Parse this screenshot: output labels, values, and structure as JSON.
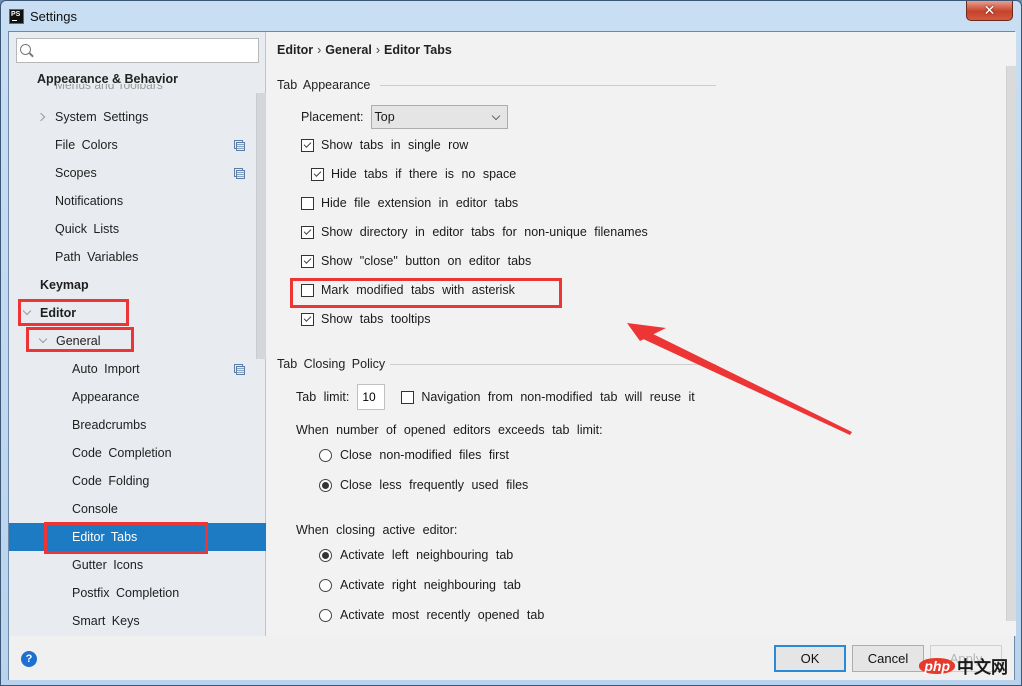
{
  "window": {
    "title": "Settings",
    "app_icon": "phpstorm-logo",
    "close_label": "✕"
  },
  "sidebar": {
    "search": {
      "value": "",
      "placeholder": ""
    },
    "section_header": "Appearance & Behavior",
    "cut_item": "Menus and Toolbars",
    "items": [
      {
        "label": "System  Settings",
        "level": 1,
        "expander": "collapsed"
      },
      {
        "label": "File  Colors",
        "level": 1,
        "project_icon": true
      },
      {
        "label": "Scopes",
        "level": 1,
        "project_icon": true
      },
      {
        "label": "Notifications",
        "level": 1
      },
      {
        "label": "Quick  Lists",
        "level": 1
      },
      {
        "label": "Path  Variables",
        "level": 1
      },
      {
        "label": "Keymap",
        "level": 0,
        "bold": true
      },
      {
        "label": "Editor",
        "level": 0,
        "bold": true,
        "expander": "expanded",
        "highlighted": true
      },
      {
        "label": "General",
        "level": 1,
        "expander": "expanded",
        "highlighted": true
      },
      {
        "label": "Auto  Import",
        "level": 2,
        "project_icon": true
      },
      {
        "label": "Appearance",
        "level": 2
      },
      {
        "label": "Breadcrumbs",
        "level": 2
      },
      {
        "label": "Code  Completion",
        "level": 2
      },
      {
        "label": "Code  Folding",
        "level": 2
      },
      {
        "label": "Console",
        "level": 2
      },
      {
        "label": "Editor  Tabs",
        "level": 2,
        "selected": true,
        "highlighted": true
      },
      {
        "label": "Gutter  Icons",
        "level": 2
      },
      {
        "label": "Postfix  Completion",
        "level": 2
      },
      {
        "label": "Smart  Keys",
        "level": 2
      }
    ]
  },
  "main": {
    "breadcrumb": [
      "Editor",
      "General",
      "Editor Tabs"
    ],
    "breadcrumb_separator": "›",
    "tab_appearance": {
      "title": "Tab  Appearance",
      "placement_label": "Placement:",
      "placement_value": "Top",
      "options": [
        {
          "label": "Show  tabs  in  single  row",
          "checked": true
        },
        {
          "label": "Hide  tabs  if  there  is  no  space",
          "checked": true
        },
        {
          "label": "Hide  file  extension  in  editor  tabs",
          "checked": false
        },
        {
          "label": "Show  directory  in  editor  tabs  for  non-unique  filenames",
          "checked": true
        },
        {
          "label": "Show  \"close\"  button  on  editor  tabs",
          "checked": true
        },
        {
          "label": "Mark  modified  tabs  with  asterisk",
          "checked": false,
          "highlighted": true
        },
        {
          "label": "Show  tabs  tooltips",
          "checked": true
        }
      ]
    },
    "tab_closing": {
      "title": "Tab  Closing  Policy",
      "tab_limit_label": "Tab  limit:",
      "tab_limit_value": "10",
      "navigation_reuse": {
        "label": "Navigation  from  non-modified  tab  will  reuse  it",
        "checked": false
      },
      "exceeds_label": "When  number  of  opened  editors  exceeds  tab  limit:",
      "exceeds_options": [
        {
          "label": "Close  non-modified  files  first",
          "checked": false
        },
        {
          "label": "Close  less  frequently  used  files",
          "checked": true
        }
      ],
      "closing_label": "When  closing  active  editor:",
      "closing_options": [
        {
          "label": "Activate  left  neighbouring  tab",
          "checked": true
        },
        {
          "label": "Activate  right  neighbouring  tab",
          "checked": false
        },
        {
          "label": "Activate  most  recently  opened  tab",
          "checked": false
        }
      ]
    }
  },
  "footer": {
    "help_label": "?",
    "ok_label": "OK",
    "cancel_label": "Cancel",
    "apply_label": "Apply",
    "apply_enabled": false
  },
  "annotations": {
    "color": "#ee3535",
    "arrow_target": "Mark modified tabs with asterisk"
  },
  "watermark": {
    "badge": "php",
    "text": "中文网"
  }
}
